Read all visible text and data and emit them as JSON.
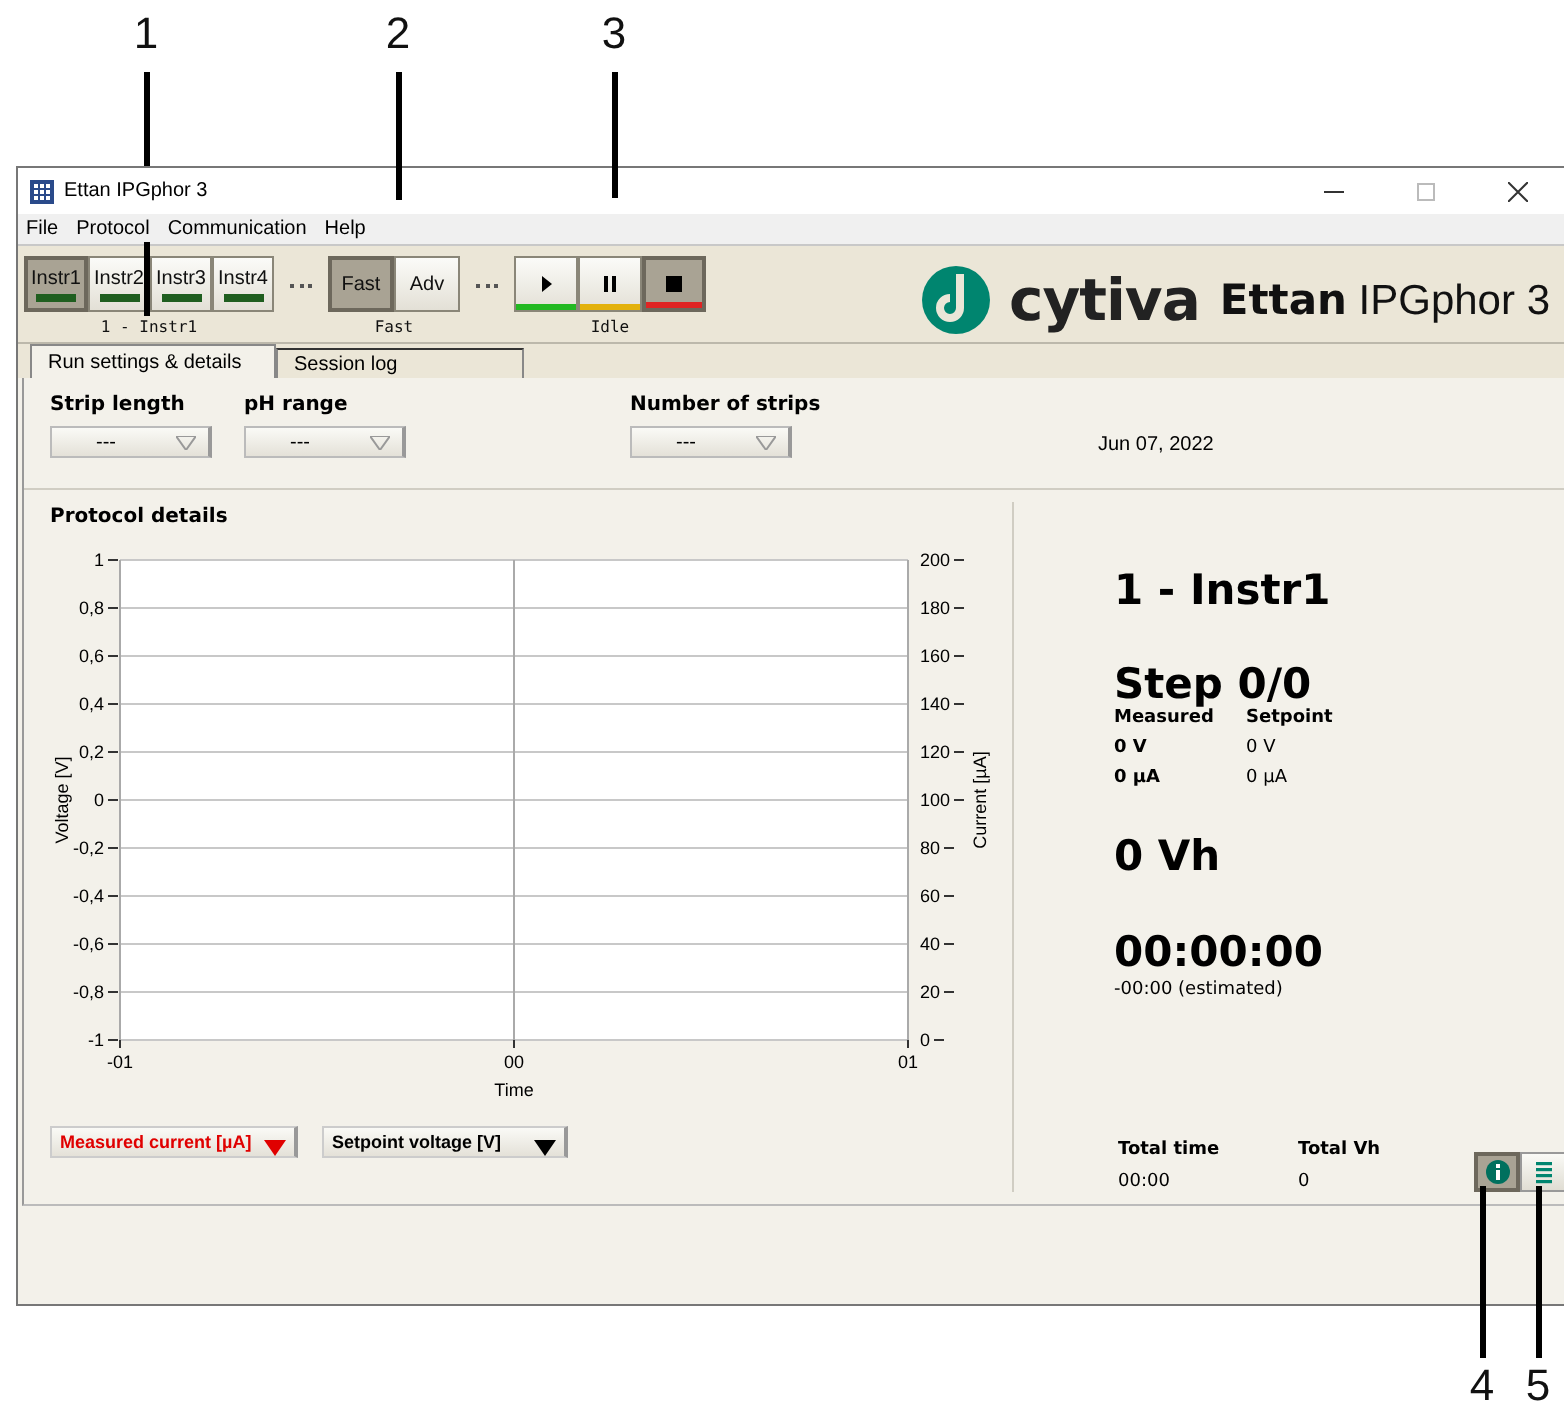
{
  "callouts": {
    "top": [
      {
        "label": "1"
      },
      {
        "label": "2"
      },
      {
        "label": "3"
      }
    ],
    "bottom": [
      {
        "label": "4"
      },
      {
        "label": "5"
      }
    ]
  },
  "window": {
    "title": "Ettan IPGphor 3"
  },
  "menu": [
    "File",
    "Protocol",
    "Communication",
    "Help"
  ],
  "instruments": {
    "caption": "1 - Instr1",
    "buttons": [
      {
        "label": "Instr1",
        "selected": true
      },
      {
        "label": "Instr2",
        "selected": false
      },
      {
        "label": "Instr3",
        "selected": false
      },
      {
        "label": "Instr4",
        "selected": false
      }
    ]
  },
  "mode": {
    "caption": "Fast",
    "buttons": [
      {
        "label": "Fast",
        "selected": true
      },
      {
        "label": "Adv",
        "selected": false
      }
    ]
  },
  "run_controls": {
    "caption": "Idle",
    "buttons": [
      {
        "kind": "play",
        "color": "#22b922",
        "selected": false
      },
      {
        "kind": "pause",
        "color": "#e3b10c",
        "selected": false
      },
      {
        "kind": "stop",
        "color": "#e02424",
        "selected": true
      }
    ]
  },
  "brand": {
    "logo": "cytiva",
    "product_bold": "Ettan",
    "product": "IPGphor 3"
  },
  "tabs": [
    {
      "label": "Run settings & details",
      "selected": true
    },
    {
      "label": "Session log",
      "selected": false
    }
  ],
  "settings": [
    {
      "label": "Strip length",
      "value": "---"
    },
    {
      "label": "pH range",
      "value": "---"
    },
    {
      "label": "Number of strips",
      "value": "---"
    }
  ],
  "date": "Jun 07, 2022",
  "protocol_details": {
    "title": "Protocol details",
    "chart_data": {
      "type": "line",
      "xlabel": "Time",
      "ylabel": "Voltage [V]",
      "xlim": [
        -1,
        1
      ],
      "ylim": [
        -1,
        1
      ],
      "grid": true,
      "xticks": [
        {
          "value": -1,
          "label": "-01"
        },
        {
          "value": 0,
          "label": "00"
        },
        {
          "value": 1,
          "label": "01"
        }
      ],
      "yticks": [
        {
          "value": 1,
          "label": "1"
        },
        {
          "value": 0.8,
          "label": "0,8"
        },
        {
          "value": 0.6,
          "label": "0,6"
        },
        {
          "value": 0.4,
          "label": "0,4"
        },
        {
          "value": 0.2,
          "label": "0,2"
        },
        {
          "value": 0,
          "label": "0"
        },
        {
          "value": -0.2,
          "label": "-0,2"
        },
        {
          "value": -0.4,
          "label": "-0,4"
        },
        {
          "value": -0.6,
          "label": "-0,6"
        },
        {
          "value": -0.8,
          "label": "-0,8"
        },
        {
          "value": -1,
          "label": "-1"
        }
      ]
    },
    "right_axis": {
      "label": "Current [µA]",
      "ticks": [
        "200",
        "180",
        "160",
        "140",
        "120",
        "100",
        "80",
        "60",
        "40",
        "20",
        "0"
      ]
    },
    "selectors": [
      {
        "label": "Measured current [µA]",
        "color": "#e00000"
      },
      {
        "label": "Setpoint voltage [V]",
        "color": "#000000"
      }
    ]
  },
  "status": {
    "instrument": "1 - Instr1",
    "step": "Step 0/0",
    "columns": [
      {
        "heading": "Measured",
        "bold": true,
        "values": [
          "0 V",
          "0 µA"
        ]
      },
      {
        "heading": "Setpoint",
        "bold": false,
        "values": [
          "0 V",
          "0 µA"
        ]
      }
    ],
    "vh": "0 Vh",
    "elapsed": "00:00:00",
    "estimated": "-00:00 (estimated)",
    "totals": [
      {
        "heading": "Total time",
        "value": "00:00"
      },
      {
        "heading": "Total Vh",
        "value": "0"
      }
    ]
  },
  "view_buttons": [
    {
      "kind": "info",
      "selected": true
    },
    {
      "kind": "list",
      "selected": false
    }
  ]
}
